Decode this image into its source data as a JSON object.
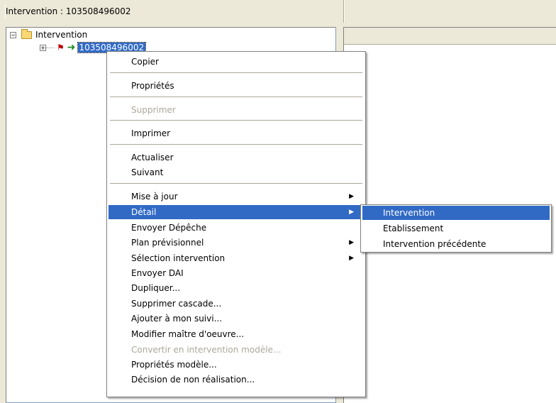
{
  "header": {
    "title": "Intervention : 103508496002"
  },
  "tree": {
    "root_label": "Intervention",
    "root_expander": "−",
    "child_expander": "+",
    "child_label": "103508496002",
    "flag_icon": "flag-icon",
    "arrow_icon": "arrow-icon"
  },
  "context_menu": {
    "items": [
      {
        "label": "Copier",
        "disabled": false
      },
      {
        "label": "Propriétés",
        "disabled": false
      },
      {
        "label": "Supprimer",
        "disabled": true
      },
      {
        "label": "Imprimer",
        "disabled": false
      },
      {
        "label": "Actualiser",
        "disabled": false
      },
      {
        "label": "Suivant",
        "disabled": false
      },
      {
        "label": "Mise à jour",
        "disabled": false,
        "submenu": true
      },
      {
        "label": "Détail",
        "disabled": false,
        "submenu": true,
        "active": true
      },
      {
        "label": "Envoyer Dépêche",
        "disabled": false
      },
      {
        "label": "Plan prévisionnel",
        "disabled": false,
        "submenu": true
      },
      {
        "label": "Sélection intervention",
        "disabled": false,
        "submenu": true
      },
      {
        "label": "Envoyer DAI",
        "disabled": false
      },
      {
        "label": "Dupliquer...",
        "disabled": false
      },
      {
        "label": "Supprimer cascade...",
        "disabled": false
      },
      {
        "label": "Ajouter à mon suivi...",
        "disabled": false
      },
      {
        "label": "Modifier maître d'oeuvre...",
        "disabled": false
      },
      {
        "label": "Convertir en intervention modèle...",
        "disabled": true
      },
      {
        "label": "Propriétés modèle...",
        "disabled": false
      },
      {
        "label": "Décision de non réalisation...",
        "disabled": false
      }
    ],
    "submenu_arrow": "▶"
  },
  "sub_menu": {
    "items": [
      {
        "label": "Intervention",
        "active": true
      },
      {
        "label": "Etablissement",
        "active": false
      },
      {
        "label": "Intervention précédente",
        "active": false
      }
    ]
  },
  "colors": {
    "highlight": "#316ac5",
    "disabled": "#aca899"
  }
}
